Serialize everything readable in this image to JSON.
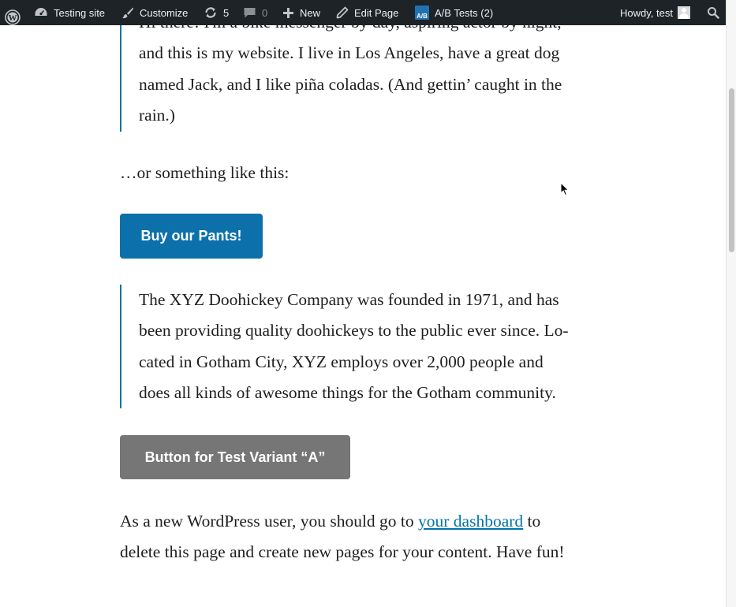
{
  "admin_bar": {
    "site_name": "Testing site",
    "customize_label": "Customize",
    "updates_count": "5",
    "comments_count": "0",
    "new_label": "New",
    "edit_page_label": "Edit Page",
    "ab_badge": "A/B",
    "ab_tests_label": "A/B Tests (2)",
    "howdy_label": "Howdy, test"
  },
  "content": {
    "quote1_lines": [
      "Hi there! I'm a bike messenger by day, aspiring actor by night,",
      "and this is my website. I live in Los Angeles, have a great dog",
      "named Jack, and I like piña coladas. (And gettin’ caught in the",
      "rain.)"
    ],
    "para1": "…or something like this:",
    "button_primary": "Buy our Pants!",
    "quote2_lines": [
      "The XYZ Doohickey Company was founded in 1971, and has",
      "been providing quality doohickeys to the public ever since. Lo-",
      "cated in Gotham City, XYZ employs over 2,000 people and",
      "does all kinds of awesome things for the Gotham community."
    ],
    "button_variant": "Button for Test Variant “A”",
    "para2_before_link": "As a new WordPress user, you should go to ",
    "para2_link": "your dashboard",
    "para2_after_link": " to",
    "para2_line2": "delete this page and create new pages for your content. Have fun!"
  },
  "colors": {
    "admin_bar_bg": "#1d2327",
    "link": "#0073aa",
    "button_primary_bg": "#0c71ab",
    "button_variant_bg": "#767676"
  }
}
